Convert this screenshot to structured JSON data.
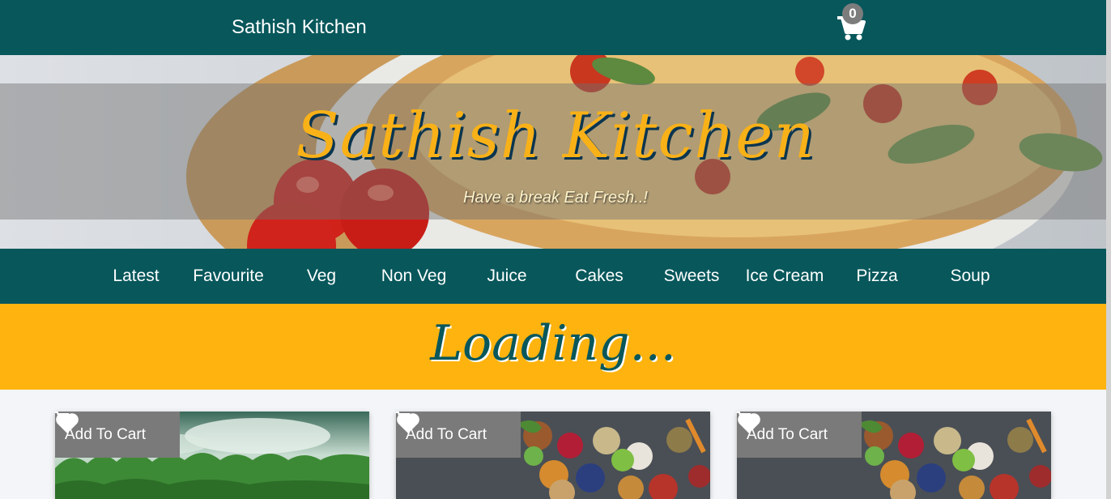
{
  "header": {
    "brand": "Sathish Kitchen",
    "cart_count": "0"
  },
  "hero": {
    "title": "Sathish Kitchen",
    "tagline": "Have a break Eat Fresh..!"
  },
  "nav": {
    "items": [
      "Latest",
      "Favourite",
      "Veg",
      "Non Veg",
      "Juice",
      "Cakes",
      "Sweets",
      "Ice Cream",
      "Pizza",
      "Soup"
    ]
  },
  "loading": {
    "text": "Loading..."
  },
  "cards": [
    {
      "add_label": "Add To Cart",
      "image": "forest-landscape"
    },
    {
      "add_label": "Add To Cart",
      "image": "vegetable-bowls"
    },
    {
      "add_label": "Add To Cart",
      "image": "vegetable-bowls"
    }
  ],
  "colors": {
    "primary": "#07575b",
    "accent": "#feb30e",
    "button": "#7a7a7a",
    "title": "#f9b118"
  }
}
